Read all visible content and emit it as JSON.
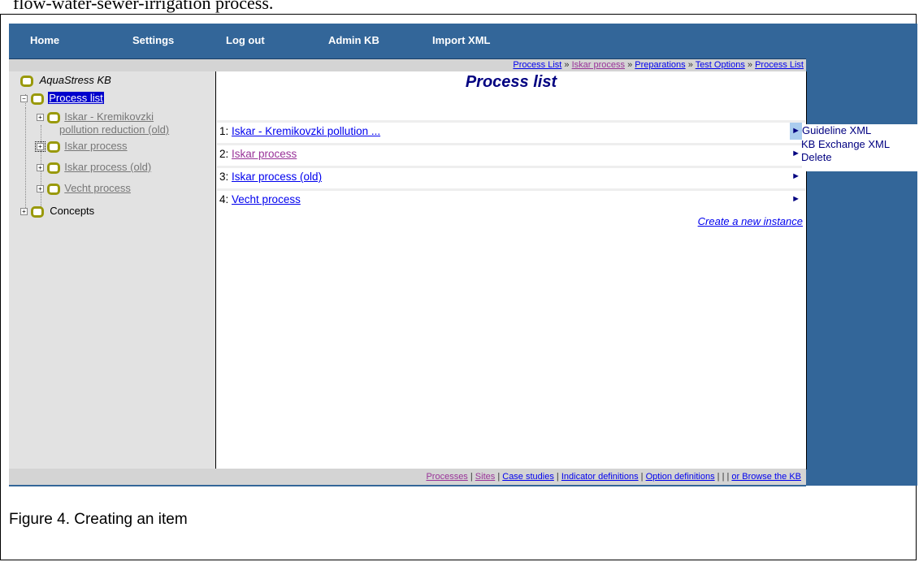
{
  "doc": {
    "top_text": "flow-water-sewer-irrigation process.",
    "caption": "Figure 4. Creating an item"
  },
  "nav": [
    "Home",
    "Settings",
    "Log out",
    "Admin KB",
    "Import XML"
  ],
  "breadcrumb": {
    "items": [
      "Process List",
      "Iskar process",
      "Preparations",
      "Test Options",
      "Process List"
    ],
    "separator": "»"
  },
  "tree": {
    "root": "AquaStress KB",
    "process_list": "Process list",
    "children": [
      "Iskar - Kremikovzki",
      "pollution reduction (old)",
      "Iskar process",
      "Iskar process (old)",
      "Vecht process"
    ],
    "concepts": "Concepts"
  },
  "main": {
    "title": "Process list",
    "rows": [
      {
        "num": "1:",
        "label": "Iskar - Kremikovzki pollution ..."
      },
      {
        "num": "2:",
        "label": "Iskar process"
      },
      {
        "num": "3:",
        "label": "Iskar process (old)"
      },
      {
        "num": "4:",
        "label": "Vecht process"
      }
    ],
    "arrow": "►",
    "create_link": "Create a new instance"
  },
  "context_menu": [
    "Guideline XML",
    "KB Exchange XML",
    "Delete"
  ],
  "footer": {
    "links": [
      "Processes",
      "Sites",
      "Case studies",
      "Indicator definitions",
      "Option definitions"
    ],
    "separator": "|",
    "triple_sep": "| | |",
    "browse": "or Browse the KB"
  },
  "colors": {
    "nav_bg": "#336699",
    "bar_bg": "#d4d4d4",
    "sidebar_bg": "#e2e2e2",
    "link": "#0000ee",
    "visited": "#993399",
    "title": "#000080",
    "node_ring": "#99990a"
  }
}
